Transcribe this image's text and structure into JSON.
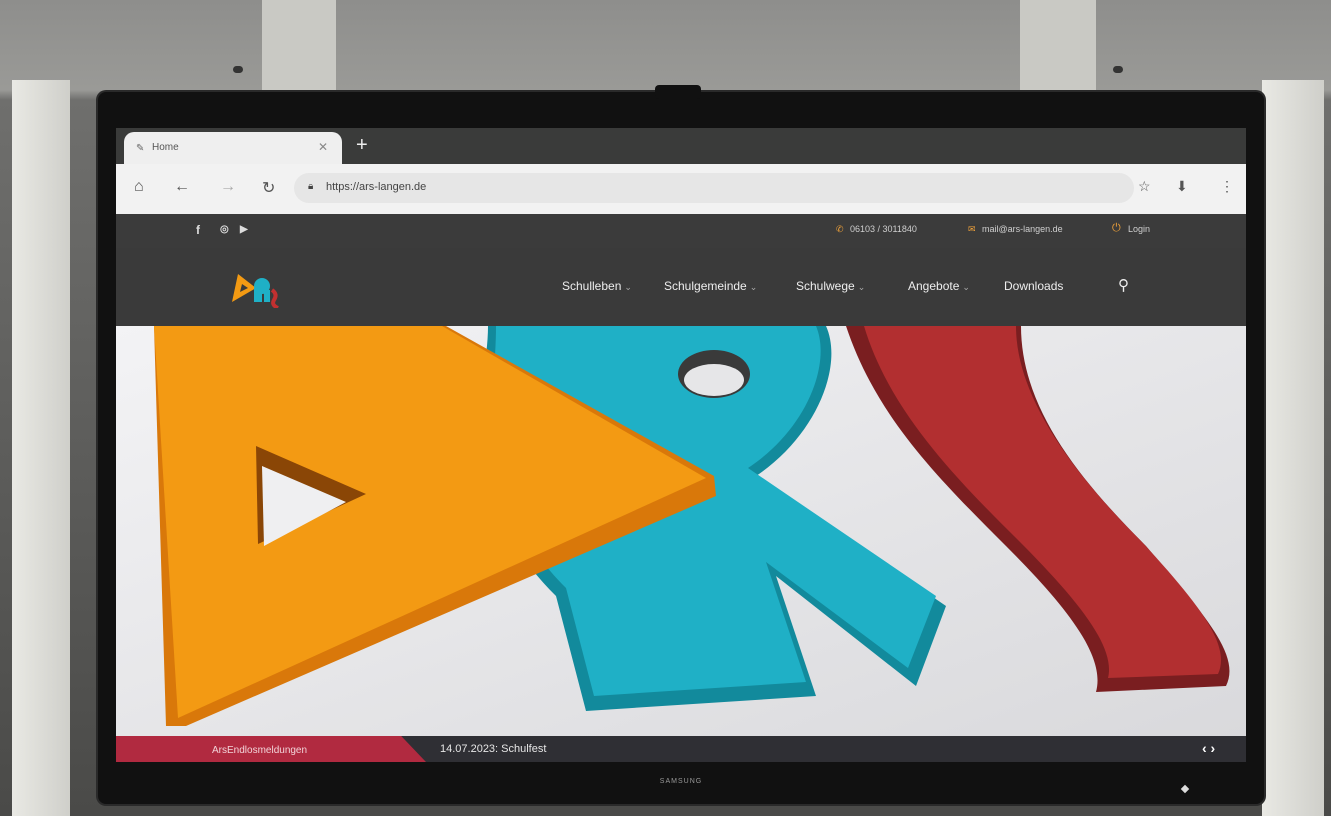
{
  "browser": {
    "tab_title": "Home",
    "tab_close": "✕",
    "new_tab": "+",
    "url": "https://ars-langen.de",
    "icons": [
      "home-icon",
      "back-icon",
      "forward-icon",
      "reload-icon",
      "star-icon",
      "download-icon",
      "menu-icon"
    ]
  },
  "topbar": {
    "social": [
      "f",
      "◎",
      "▶"
    ],
    "phone": "06103 / 3011840",
    "email": "mail@ars-langen.de",
    "login": "Login"
  },
  "nav": {
    "items": [
      {
        "label": "Schulleben",
        "caret": "⌄"
      },
      {
        "label": "Schulgemeinde",
        "caret": "⌄"
      },
      {
        "label": "Schulwege",
        "caret": "⌄"
      },
      {
        "label": "Angebote",
        "caret": "⌄"
      },
      {
        "label": "Downloads",
        "caret": ""
      }
    ]
  },
  "ticker": {
    "label": "ArsEndlosmeldungen",
    "text": "14.07.2023: Schulfest",
    "nav": "‹ ›"
  },
  "monitor": {
    "brand": "SAMSUNG"
  },
  "colors": {
    "orange": "#f39a13",
    "teal": "#1fb0c6",
    "red": "#b22f30",
    "nav_bg": "#3a3a3a",
    "ticker_accent": "#b12a40"
  }
}
